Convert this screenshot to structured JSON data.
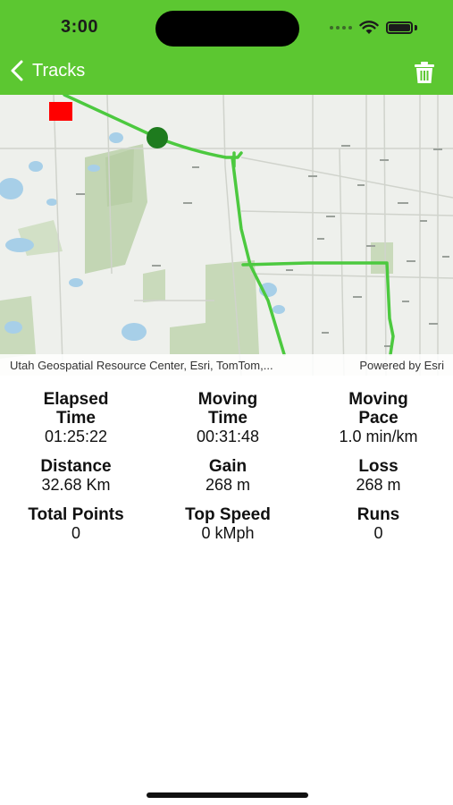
{
  "status_bar": {
    "time": "3:00"
  },
  "nav": {
    "back_label": "Tracks"
  },
  "map": {
    "attribution": "Utah Geospatial Resource Center, Esri, TomTom,...",
    "powered_by": "Powered by Esri",
    "track_color": "#4cc93f",
    "start_marker_color": "#1e7b1e",
    "end_marker_color": "#ff0000"
  },
  "stats": [
    {
      "title": "Elapsed\nTime",
      "value": "01:25:22"
    },
    {
      "title": "Moving\nTime",
      "value": "00:31:48"
    },
    {
      "title": "Moving\nPace",
      "value": "1.0 min/km"
    },
    {
      "title": "Distance",
      "value": "32.68 Km"
    },
    {
      "title": "Gain",
      "value": "268 m"
    },
    {
      "title": "Loss",
      "value": "268 m"
    },
    {
      "title": "Total Points",
      "value": "0"
    },
    {
      "title": "Top Speed",
      "value": "0 kMph"
    },
    {
      "title": "Runs",
      "value": "0"
    }
  ],
  "colors": {
    "accent": "#5cc731"
  }
}
